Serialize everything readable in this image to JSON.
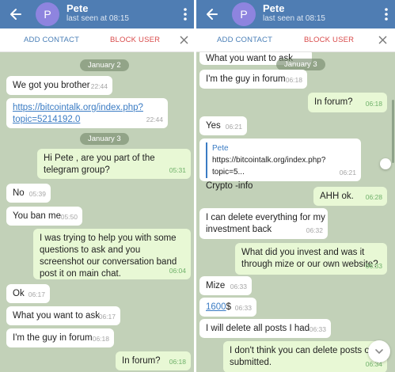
{
  "header": {
    "avatar_letter": "P",
    "name": "Pete",
    "status": "last seen at 08:15",
    "color": "#4f7db3"
  },
  "actionbar": {
    "add_contact": "ADD CONTACT",
    "block_user": "BLOCK USER"
  },
  "left": {
    "date1": "January 2",
    "m1_text": "We got you brother",
    "m1_time": "22:44",
    "m2_link": "https://bitcointalk.org/index.php?topic=5214192.0",
    "m2_time": "22:44",
    "date2": "January 3",
    "m3_text": "Hi Pete , are you part of the telegram group?",
    "m3_time": "05:31",
    "m4_text": "No",
    "m4_time": "05:39",
    "m5_text": "You ban me",
    "m5_time": "05:50",
    "m6_text": "I was trying to help you with some questions to ask and you screenshot our conversation band post it on main chat.",
    "m6_time": "06:04",
    "m7_text": "Ok",
    "m7_time": "06:17",
    "m8_text": "What you want to ask",
    "m8_time": "06:17",
    "m9_text": "I'm the guy in forum",
    "m9_time": "06:18",
    "m10_text": "In forum?",
    "m10_time": "06:18"
  },
  "right": {
    "m1_text": "What you want to ask",
    "date_pill": "January 3",
    "m2_text": "I'm the guy in forum",
    "m2_time": "06:18",
    "m3_text": "In forum?",
    "m3_time": "06:18",
    "m4_text": "Yes",
    "m4_time": "06:21",
    "m5_fwd_name": "Pete",
    "m5_fwd_text": "https://bitcointalk.org/index.php?topic=5...",
    "m5_text": "Crypto -info",
    "m5_time": "06:21",
    "m6_text": "AHH ok.",
    "m6_time": "06:28",
    "m7_text": "I can delete everything for my investment back",
    "m7_time": "06:32",
    "m8_text": "What did you invest and was it through mize or our own website?",
    "m8_time": "06:33",
    "m9_text": "Mize",
    "m9_time": "06:33",
    "m10_link": "1600",
    "m10_text": "$",
    "m10_time": "06:33",
    "m11_text": "I will delete all posts I had",
    "m11_time": "06:33",
    "m12_text": "I don't think you can delete posts o submitted.",
    "m12_time": "06:34"
  }
}
